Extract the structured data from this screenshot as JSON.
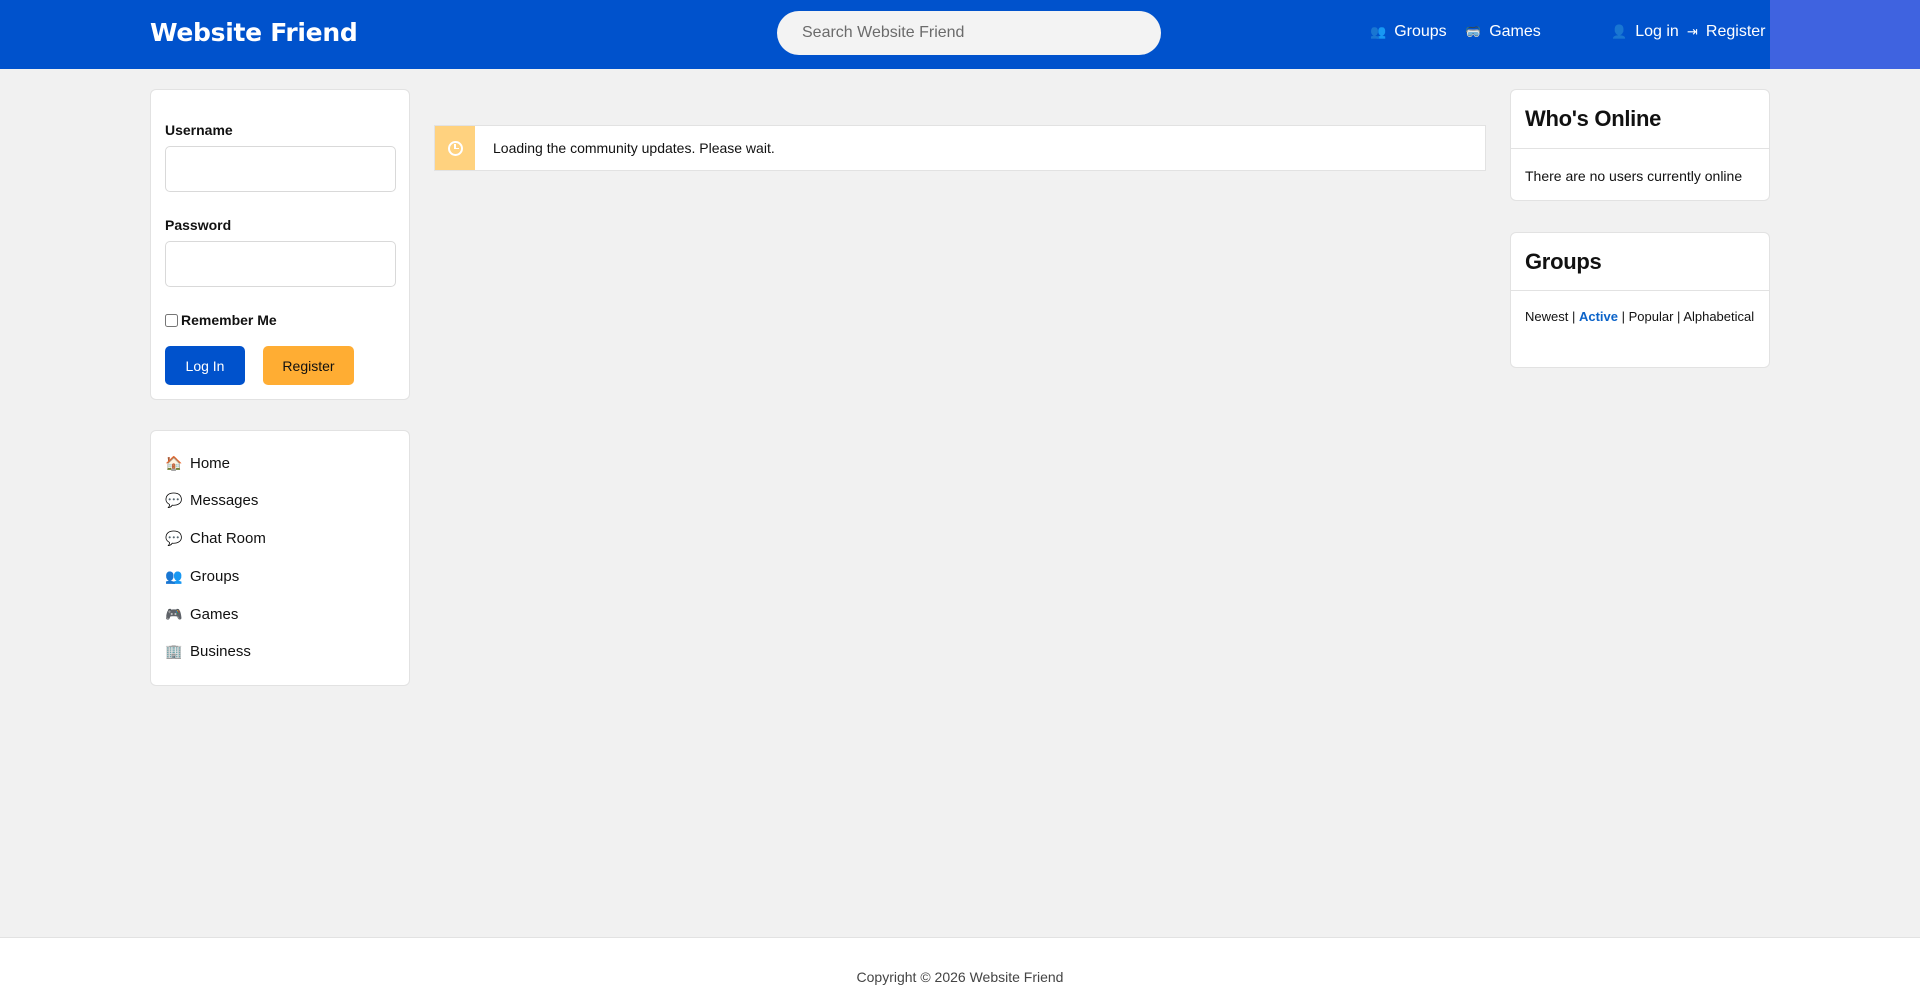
{
  "header": {
    "brand": "Website Friend",
    "search_placeholder": "Search Website Friend",
    "nav": [
      {
        "label": "Groups",
        "icon": "groups-icon",
        "glyph": "👥"
      },
      {
        "label": "Games",
        "icon": "games-icon",
        "glyph": "🥽"
      },
      {
        "label": "Log in",
        "icon": "user-icon",
        "glyph": "👤"
      },
      {
        "label": "Register",
        "icon": "sign-in-icon",
        "glyph": "⇥"
      }
    ],
    "colors": {
      "bar": "#0052cc",
      "accent": "#3f63e0"
    }
  },
  "login": {
    "username_label": "Username",
    "password_label": "Password",
    "remember_label": "Remember Me",
    "login_button": "Log In",
    "register_button": "Register"
  },
  "menu": [
    {
      "label": "Home",
      "icon": "home-icon",
      "glyph": "🏠"
    },
    {
      "label": "Messages",
      "icon": "messages-icon",
      "glyph": "💬"
    },
    {
      "label": "Chat Room",
      "icon": "chat-icon",
      "glyph": "💬"
    },
    {
      "label": "Groups",
      "icon": "groups-icon",
      "glyph": "👥"
    },
    {
      "label": "Games",
      "icon": "gamepad-icon",
      "glyph": "🎮"
    },
    {
      "label": "Business",
      "icon": "building-icon",
      "glyph": "🏢"
    }
  ],
  "alert": {
    "text": "Loading the community updates. Please wait.",
    "icon": "clock-icon",
    "color": "#ffd27f"
  },
  "online": {
    "title": "Who's Online",
    "text": "There are no users currently online"
  },
  "groups": {
    "title": "Groups",
    "sort": [
      "Newest",
      "Active",
      "Popular",
      "Alphabetical"
    ],
    "active_sort": "Active"
  },
  "footer": {
    "copyright": "Copyright © 2026 Website Friend"
  }
}
